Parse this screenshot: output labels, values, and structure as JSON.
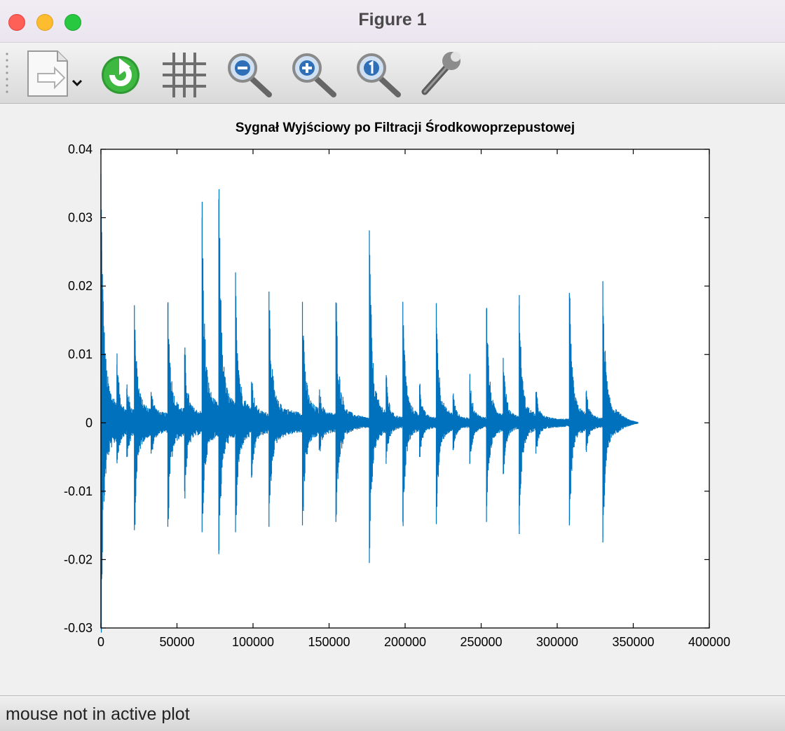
{
  "window": {
    "title": "Figure 1"
  },
  "toolbar": {
    "buttons": [
      {
        "icon": "document-export-icon",
        "tooltip": "",
        "has_dropdown": true
      },
      {
        "icon": "refresh-icon"
      },
      {
        "icon": "grid-icon"
      },
      {
        "icon": "zoom-out-icon"
      },
      {
        "icon": "zoom-in-icon"
      },
      {
        "icon": "zoom-reset-icon"
      },
      {
        "icon": "settings-wrench-icon"
      }
    ]
  },
  "chart_data": {
    "type": "line",
    "title": "Sygnał Wyjściowy po Filtracji Środkowoprzepustowej",
    "xlabel": "",
    "ylabel": "",
    "xlim": [
      0,
      400000
    ],
    "ylim": [
      -0.03,
      0.04
    ],
    "xticks": [
      0,
      50000,
      100000,
      150000,
      200000,
      250000,
      300000,
      350000,
      400000
    ],
    "xtick_labels": [
      "0",
      "50000",
      "100000",
      "150000",
      "200000",
      "250000",
      "300000",
      "350000",
      "400000"
    ],
    "yticks": [
      -0.03,
      -0.02,
      -0.01,
      0,
      0.01,
      0.02,
      0.03,
      0.04
    ],
    "ytick_labels": [
      "-0.03",
      "-0.02",
      "-0.01",
      "0",
      "0.01",
      "0.02",
      "0.03",
      "0.04"
    ],
    "grid": false,
    "legend": "none",
    "series_color": "#0072bd",
    "signal_length": 353000,
    "transients": [
      {
        "x": 0,
        "pos": 0.036,
        "neg": -0.03
      },
      {
        "x": 10500,
        "pos": 0.0085,
        "neg": -0.0055
      },
      {
        "x": 17000,
        "pos": 0.005,
        "neg": -0.005
      },
      {
        "x": 22000,
        "pos": 0.0172,
        "neg": -0.0157
      },
      {
        "x": 33000,
        "pos": 0.0045,
        "neg": -0.0045
      },
      {
        "x": 44000,
        "pos": 0.0175,
        "neg": -0.0152
      },
      {
        "x": 55000,
        "pos": 0.01,
        "neg": -0.01
      },
      {
        "x": 66500,
        "pos": 0.03,
        "neg": -0.016
      },
      {
        "x": 77500,
        "pos": 0.0327,
        "neg": -0.0192
      },
      {
        "x": 88500,
        "pos": 0.022,
        "neg": -0.016
      },
      {
        "x": 99000,
        "pos": 0.006,
        "neg": -0.008
      },
      {
        "x": 110500,
        "pos": 0.0192,
        "neg": -0.0152
      },
      {
        "x": 132500,
        "pos": 0.0177,
        "neg": -0.015
      },
      {
        "x": 143500,
        "pos": 0.004,
        "neg": -0.004
      },
      {
        "x": 154500,
        "pos": 0.0176,
        "neg": -0.0145
      },
      {
        "x": 176500,
        "pos": 0.0265,
        "neg": -0.0205
      },
      {
        "x": 187500,
        "pos": 0.0065,
        "neg": -0.006
      },
      {
        "x": 198500,
        "pos": 0.0177,
        "neg": -0.0145
      },
      {
        "x": 209500,
        "pos": 0.0055,
        "neg": -0.005
      },
      {
        "x": 220500,
        "pos": 0.0175,
        "neg": -0.0148
      },
      {
        "x": 231500,
        "pos": 0.004,
        "neg": -0.004
      },
      {
        "x": 242500,
        "pos": 0.0062,
        "neg": -0.006
      },
      {
        "x": 253500,
        "pos": 0.0167,
        "neg": -0.0145
      },
      {
        "x": 264500,
        "pos": 0.0095,
        "neg": -0.0075
      },
      {
        "x": 275000,
        "pos": 0.0172,
        "neg": -0.015
      },
      {
        "x": 286000,
        "pos": 0.0045,
        "neg": -0.0045
      },
      {
        "x": 308000,
        "pos": 0.019,
        "neg": -0.015
      },
      {
        "x": 319000,
        "pos": 0.0045,
        "neg": -0.004
      },
      {
        "x": 330000,
        "pos": 0.0207,
        "neg": -0.0175
      }
    ]
  },
  "status": {
    "text": "mouse not in active plot"
  }
}
